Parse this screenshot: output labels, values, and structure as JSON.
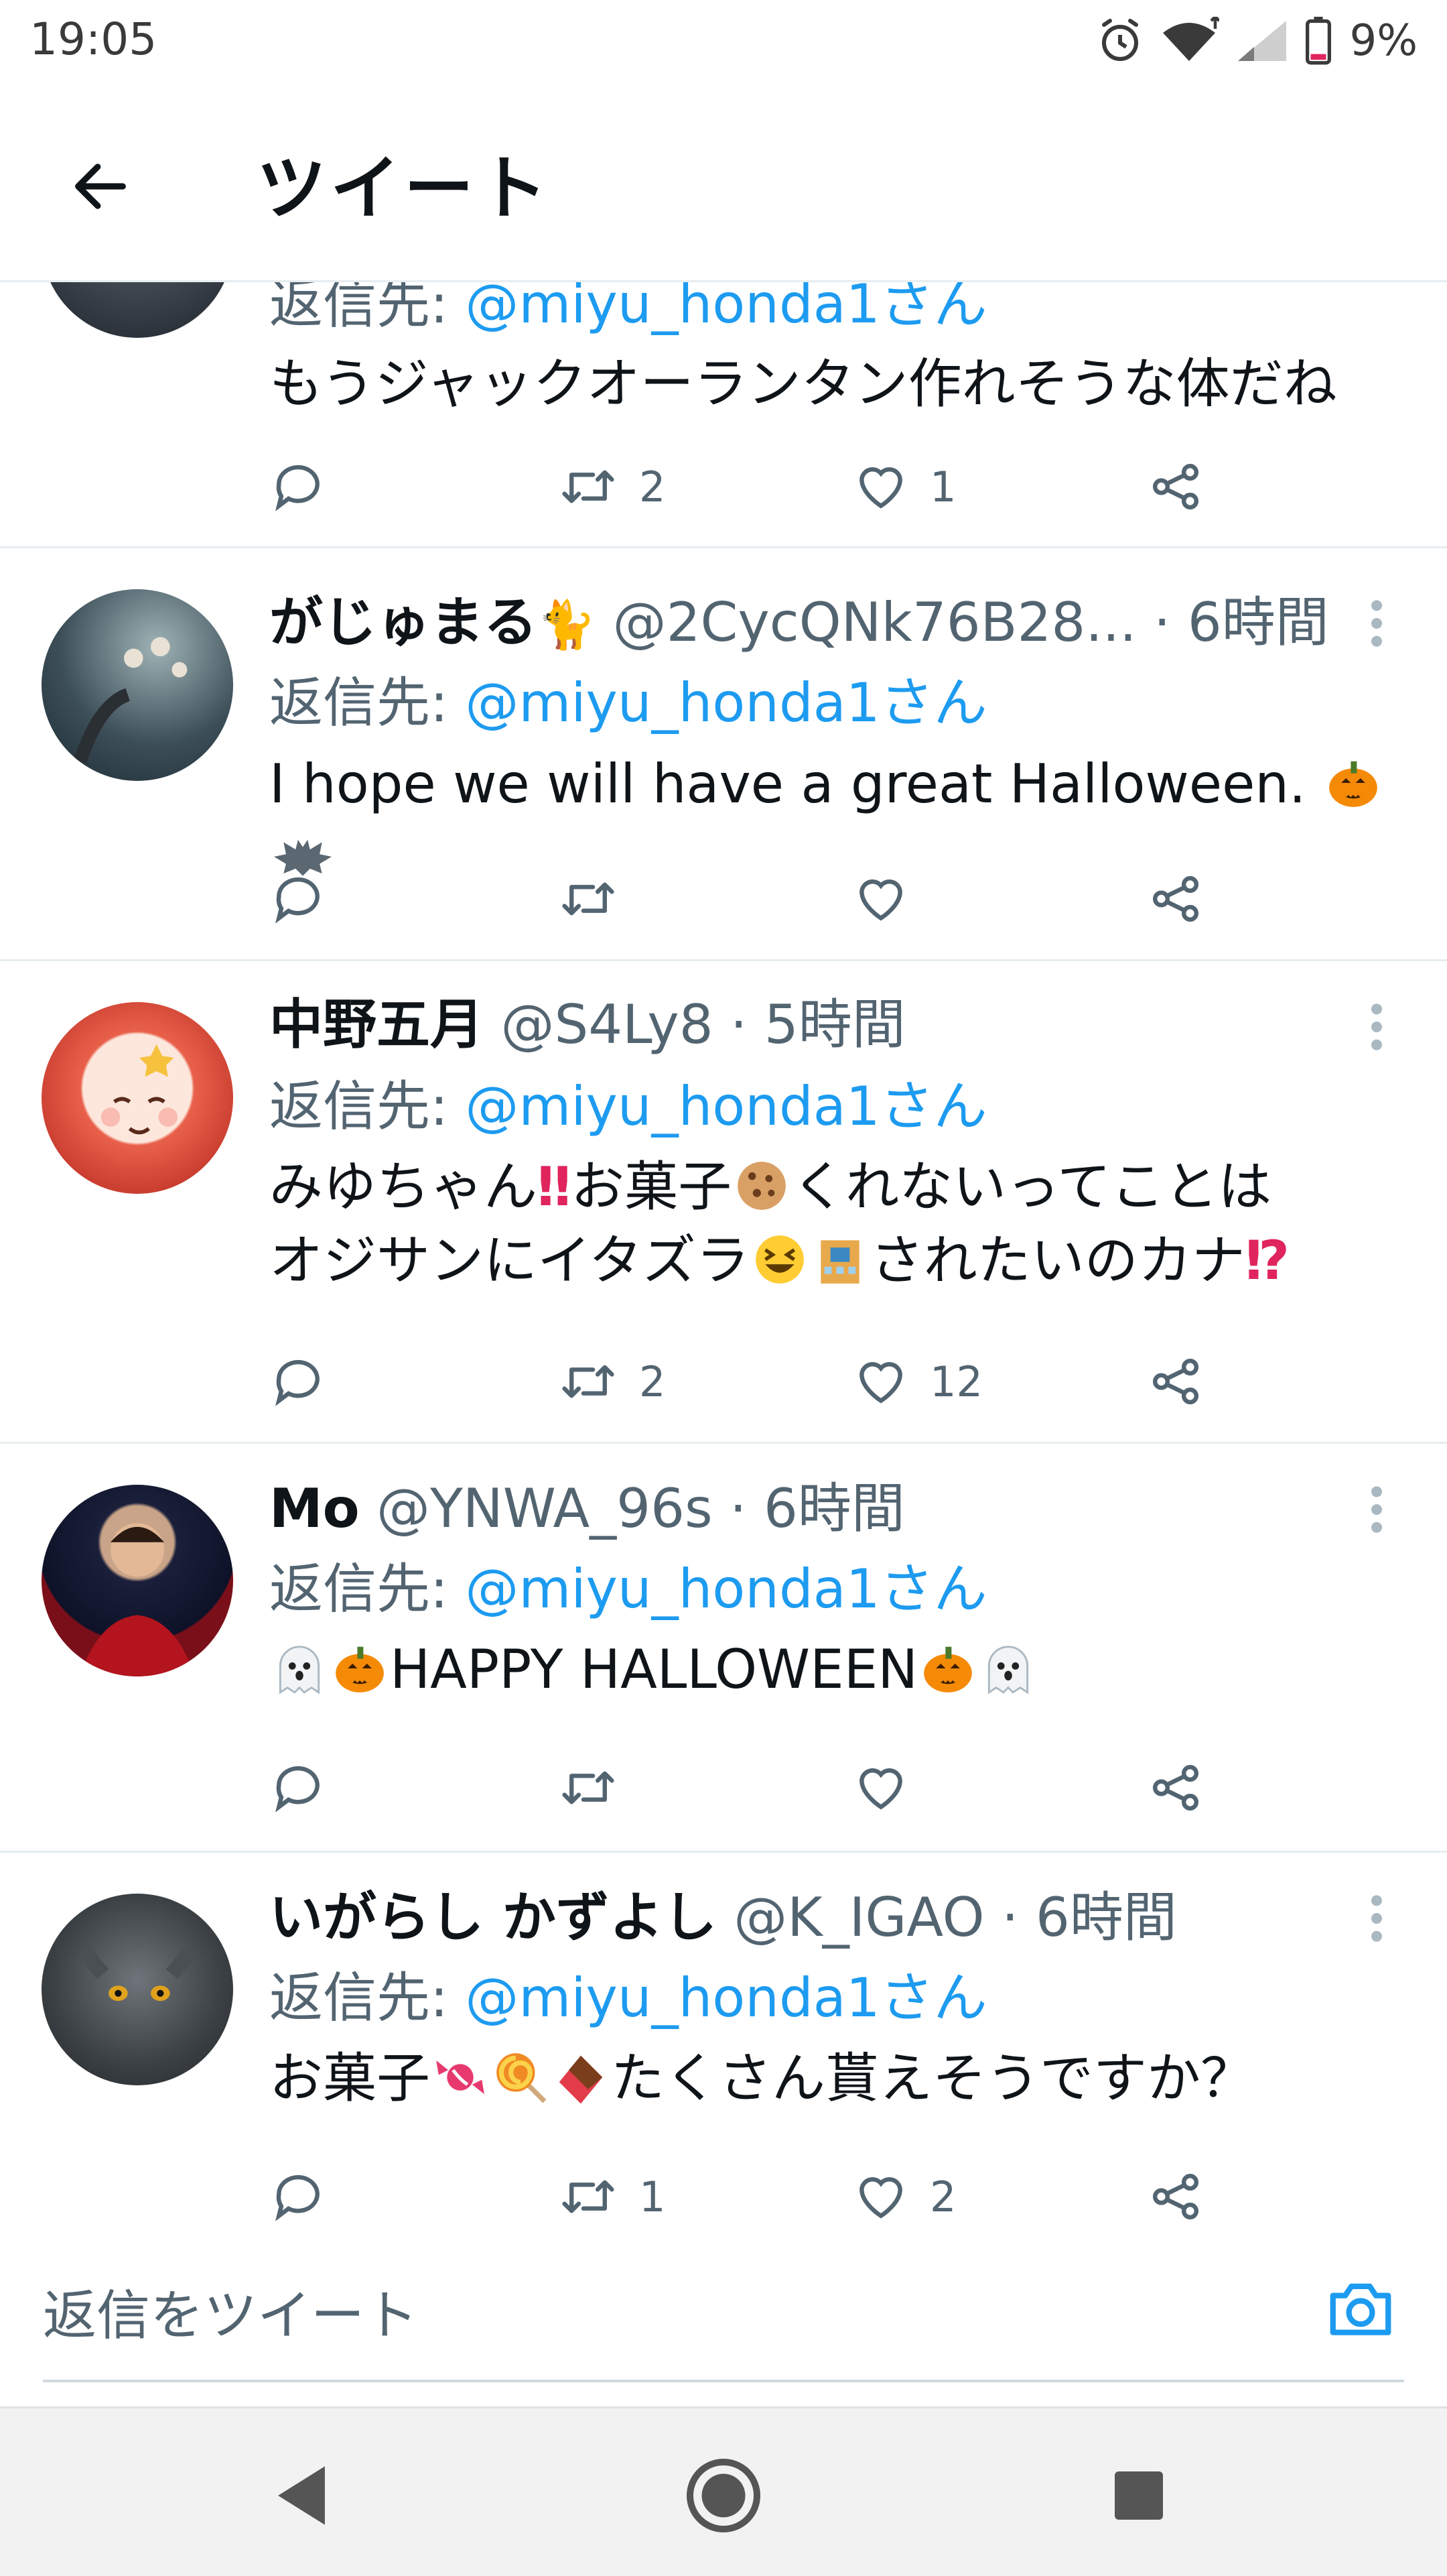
{
  "status_bar": {
    "time": "19:05",
    "battery": "9%"
  },
  "header": {
    "title": "ツイート"
  },
  "tweets": [
    {
      "reply_label": "返信先:",
      "reply_to": "@miyu_honda1さん",
      "text": "もうジャックオーランタン作れそうな体だね",
      "retweets": "2",
      "likes": "1"
    },
    {
      "name": "がじゅまる",
      "handle": "@2CycQNk76B28...",
      "time": "· 6時間",
      "reply_label": "返信先:",
      "reply_to": "@miyu_honda1さん",
      "text": "I hope we will have a great Halloween.",
      "retweets": "",
      "likes": ""
    },
    {
      "name": "中野五月",
      "handle": "@S4Ly8",
      "time": "· 5時間",
      "reply_label": "返信先:",
      "reply_to": "@miyu_honda1さん",
      "text_parts": [
        "みゆちゃん",
        "‼",
        "お菓子",
        "くれないってことは",
        "オジサンにイタズラ",
        "されたいのカナ",
        "⁉"
      ],
      "retweets": "2",
      "likes": "12"
    },
    {
      "name": "Mo",
      "handle": "@YNWA_96s",
      "time": "· 6時間",
      "reply_label": "返信先:",
      "reply_to": "@miyu_honda1さん",
      "text": "HAPPY HALLOWEEN",
      "retweets": "",
      "likes": ""
    },
    {
      "name": "いがらし かずよし",
      "handle": "@K_IGAO",
      "time": "· 6時間",
      "reply_label": "返信先:",
      "reply_to": "@miyu_honda1さん",
      "text_parts": [
        "お菓子",
        "たくさん貰えそうですか？"
      ],
      "retweets": "1",
      "likes": "2"
    }
  ],
  "reply_bar": {
    "placeholder": "返信をツイート"
  },
  "icons": {
    "back": "arrow-left-icon",
    "reply": "reply-bubble-icon",
    "retweet": "retweet-icon",
    "like": "heart-icon",
    "share": "share-icon",
    "more": "more-vertical-icon",
    "camera": "camera-icon",
    "nav": [
      "back-triangle-icon",
      "home-circle-icon",
      "recents-square-icon"
    ]
  },
  "colors": {
    "accent": "#1d9bf0",
    "text": "#0f1419",
    "secondary": "#536471",
    "divider": "#e6ecf0"
  }
}
